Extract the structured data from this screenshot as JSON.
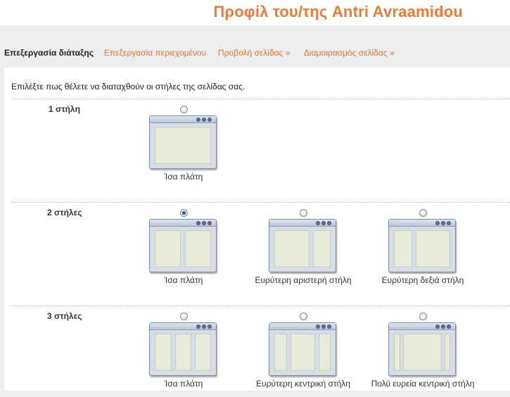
{
  "header": {
    "title": "Προφίλ του/της Antri Avraamidou"
  },
  "tabs": [
    {
      "label": "Επεξεργασία διάταξης",
      "active": true
    },
    {
      "label": "Επεξεργασία περιεχομένου",
      "active": false
    },
    {
      "label": "Προβολή σελίδας »",
      "active": false
    },
    {
      "label": "Διαμοιρασμός σελίδας »",
      "active": false
    }
  ],
  "instructions": "Επιλέξτε πως θέλετε να διαταχθούν οι στήλες της σελίδας σας.",
  "rows": [
    {
      "label": "1 στήλη",
      "options": [
        {
          "label": "Ίσα πλάτη",
          "selected": false
        }
      ]
    },
    {
      "label": "2 στήλες",
      "options": [
        {
          "label": "Ίσα πλάτη",
          "selected": true
        },
        {
          "label": "Ευρύτερη αριστερή στήλη",
          "selected": false
        },
        {
          "label": "Ευρύτερη δεξιά στήλη",
          "selected": false
        }
      ]
    },
    {
      "label": "3 στήλες",
      "options": [
        {
          "label": "Ίσα πλάτη",
          "selected": false
        },
        {
          "label": "Ευρύτερη κεντρική στήλη",
          "selected": false
        },
        {
          "label": "Πολύ ευρεία κεντρική στήλη",
          "selected": false
        }
      ]
    }
  ],
  "colors": {
    "accent": "#ee7a35",
    "link": "#e8742a",
    "background": "#eeeeee"
  }
}
